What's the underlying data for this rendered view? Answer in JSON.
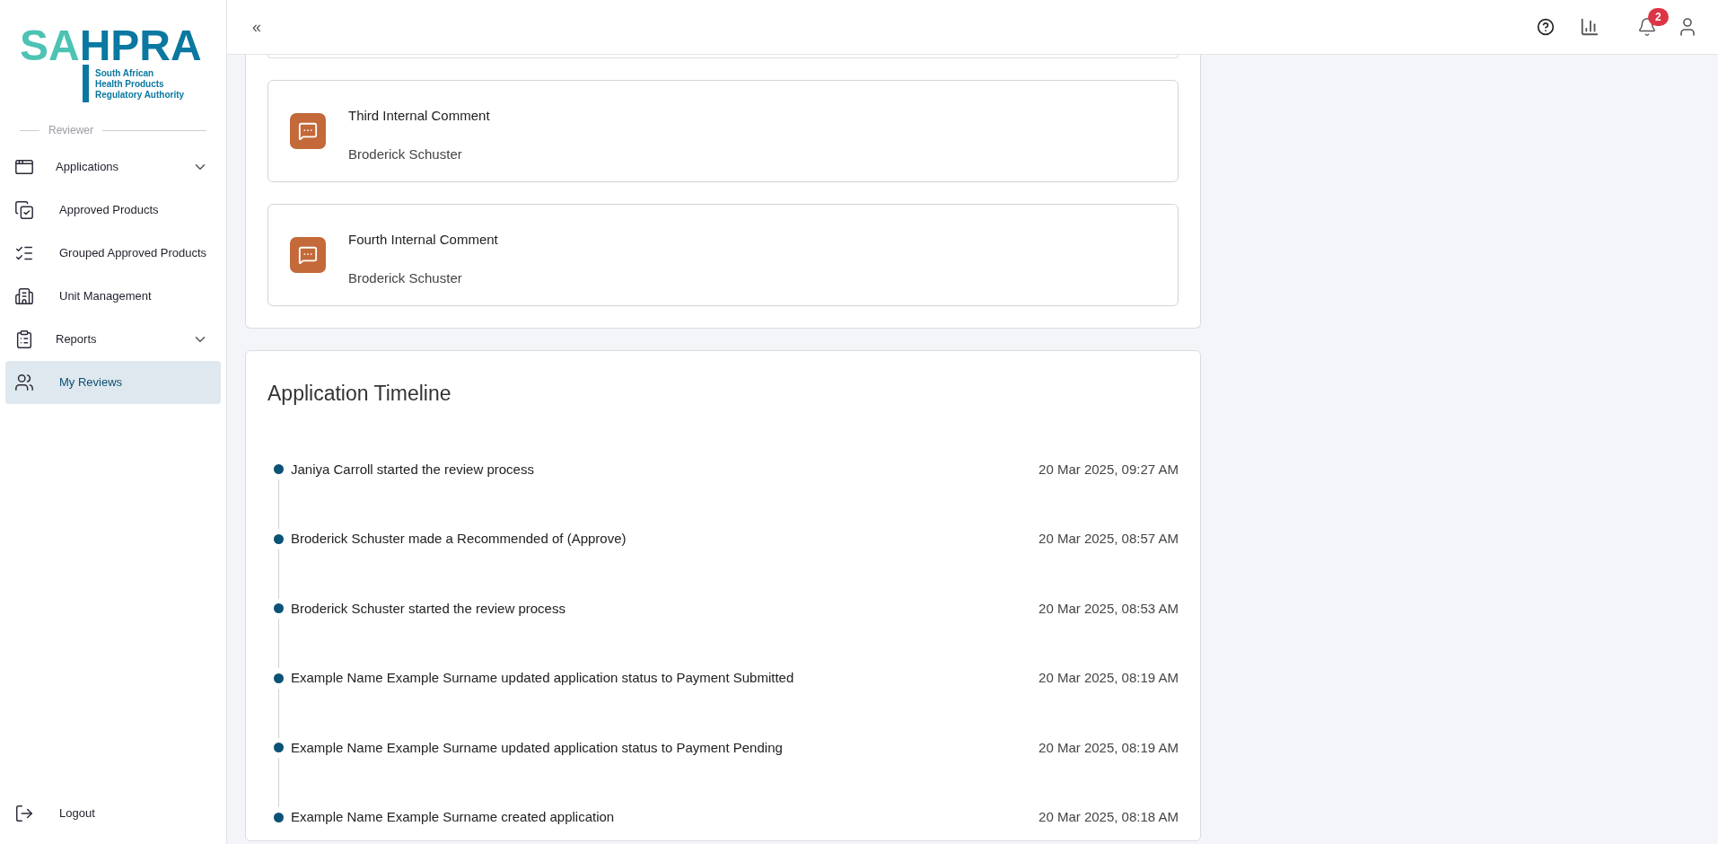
{
  "logo": {
    "letters_light": "SA",
    "letters_dark": "HPRA",
    "subtitle": [
      "South African",
      "Health Products",
      "Regulatory Authority"
    ]
  },
  "sidebar": {
    "section_label": "Reviewer",
    "items": [
      {
        "label": "Applications",
        "kind": "group",
        "selected": false
      },
      {
        "label": "Approved Products",
        "kind": "link",
        "selected": false
      },
      {
        "label": "Grouped Approved Products",
        "kind": "link",
        "selected": false
      },
      {
        "label": "Unit Management",
        "kind": "link",
        "selected": false
      },
      {
        "label": "Reports",
        "kind": "group",
        "selected": false
      },
      {
        "label": "My Reviews",
        "kind": "link",
        "selected": true
      }
    ],
    "logout": "Logout"
  },
  "topbar": {
    "collapse": "«",
    "notifications_count": "2"
  },
  "comments": [
    {
      "title": "Third Internal Comment",
      "author": "Broderick Schuster"
    },
    {
      "title": "Fourth Internal Comment",
      "author": "Broderick Schuster"
    }
  ],
  "timeline": {
    "title": "Application Timeline",
    "events": [
      {
        "text": "Janiya Carroll started the review process",
        "time": "20 Mar 2025, 09:27 AM"
      },
      {
        "text": "Broderick Schuster made a Recommended of (Approve)",
        "time": "20 Mar 2025, 08:57 AM"
      },
      {
        "text": "Broderick Schuster started the review process",
        "time": "20 Mar 2025, 08:53 AM"
      },
      {
        "text": "Example Name Example Surname updated application status to Payment Submitted",
        "time": "20 Mar 2025, 08:19 AM"
      },
      {
        "text": "Example Name Example Surname updated application status to Payment Pending",
        "time": "20 Mar 2025, 08:19 AM"
      },
      {
        "text": "Example Name Example Surname created application",
        "time": "20 Mar 2025, 08:18 AM"
      }
    ]
  }
}
